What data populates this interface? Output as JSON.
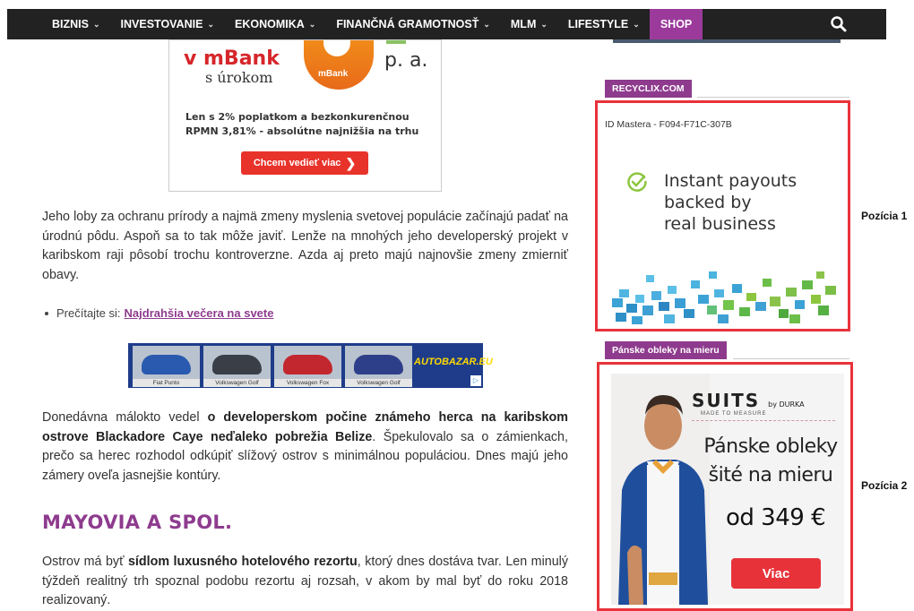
{
  "nav": {
    "items": [
      {
        "label": "BIZNIS",
        "has_dropdown": true
      },
      {
        "label": "INVESTOVANIE",
        "has_dropdown": true
      },
      {
        "label": "EKONOMIKA",
        "has_dropdown": true
      },
      {
        "label": "FINANČNÁ GRAMOTNOSŤ",
        "has_dropdown": true
      },
      {
        "label": "MLM",
        "has_dropdown": true
      },
      {
        "label": "LIFESTYLE",
        "has_dropdown": true
      }
    ],
    "shop_label": "SHOP",
    "chevron": "⌄",
    "search_icon": "search-icon",
    "background": "#222222",
    "accent": "#9b3a9b"
  },
  "top_ad": {
    "title": "v mBank",
    "subtitle": "s úrokom",
    "rate_suffix": "p. a.",
    "brand": "mBank",
    "description": "Len s 2% poplatkom a bezkonkurenčnou RPMN 3,81% - absolútne najnižšia na trhu",
    "button_label": "Chcem vedieť viac",
    "button_arrow": "❯"
  },
  "article": {
    "paragraph1": "Jeho loby za ochranu prírody a najmä zmeny myslenia svetovej populácie začínajú padať na úrodnú pôdu. Aspoň sa to tak môže javiť. Lenže na mnohých jeho developerský projekt v karibskom raji pôsobí trochu kontroverzne. Azda aj preto majú najnovšie zmeny zmierniť obavy.",
    "read_also_prefix": "Prečítajte si:",
    "read_also_link": "Najdrahšia večera na svete",
    "paragraph2_a": "Donedávna málokto vedel ",
    "paragraph2_bold": "o developerskom počine známeho herca na karibskom ostrove Blackadore Caye neďaleko pobrežia Belize",
    "paragraph2_b": ". Špekulovalo sa o zámienkach, prečo sa herec rozhodol odkúpiť slížový ostrov s minimálnou populáciou. Dnes majú jeho zámery oveľa jasnejšie kontúry.",
    "heading": "MAYOVIA A SPOL.",
    "paragraph3_a": "Ostrov má byť ",
    "paragraph3_bold": "sídlom luxusného hotelového rezortu",
    "paragraph3_b": ", ktorý dnes dostáva tvar. Len minulý týždeň realitný trh spoznal podobu rezortu aj rozsah, v akom by mal byť do roku 2018 realizovaný."
  },
  "autobazar": {
    "cars": [
      {
        "caption": "Fiat Punto",
        "color": "#2a5ab0"
      },
      {
        "caption": "Volkswagen Golf",
        "color": "#3a3f47"
      },
      {
        "caption": "Volkswagen Fox",
        "color": "#c2262e"
      },
      {
        "caption": "Volkswagen Golf",
        "color": "#2e3f8a"
      }
    ],
    "logo": "AUTOBAZAR.EU",
    "ad_icon": "▷"
  },
  "sidebar": {
    "widget1": {
      "label": "RECYCLIX.COM",
      "id_text": "ID Mastera - F094-F71C-307B",
      "tagline": [
        "Instant payouts",
        "backed by",
        "real business"
      ]
    },
    "widget2": {
      "label": "Pánske obleky na mieru",
      "brand": "SUITS",
      "brand_by": "by DURKA",
      "made_to_measure": "MADE TO MEASURE",
      "headline": [
        "Pánske obleky",
        "šité na mieru"
      ],
      "price": "od 349 €",
      "button_label": "Viac"
    },
    "highlight_color": "#e8323a"
  },
  "annotations": {
    "position1": "Pozícia 1",
    "position2": "Pozícia 2"
  }
}
